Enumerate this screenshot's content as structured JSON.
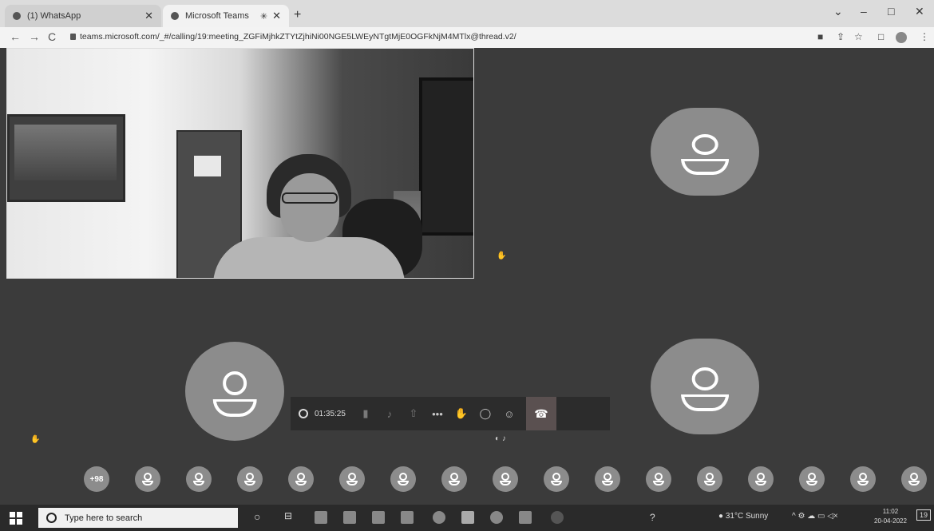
{
  "browser": {
    "tabs": [
      {
        "title": "(1) WhatsApp",
        "active": false
      },
      {
        "title": "Microsoft Teams",
        "active": true
      }
    ],
    "new_tab": "+",
    "url": "teams.microsoft.com/_#/calling/19:meeting_ZGFiMjhkZTYtZjhiNi00NGE5LWEyNTgtMjE0OGFkNjM4MTlx@thread.v2/",
    "window_controls": {
      "minimize": "–",
      "restore": "□",
      "close": "✕"
    }
  },
  "meeting": {
    "timer": "01:35:25",
    "overflow_count": "+98",
    "mini_avatar_count": 16
  },
  "taskbar": {
    "search_placeholder": "Type here to search",
    "weather": "31°C  Sunny",
    "time": "11:02",
    "date": "20-04-2022",
    "notification_count": "19"
  },
  "icons": {
    "back": "back-icon",
    "forward": "forward-icon",
    "reload": "reload-icon",
    "lock": "lock-icon",
    "star": "star-icon",
    "hangup": "phone-hangup-icon"
  }
}
